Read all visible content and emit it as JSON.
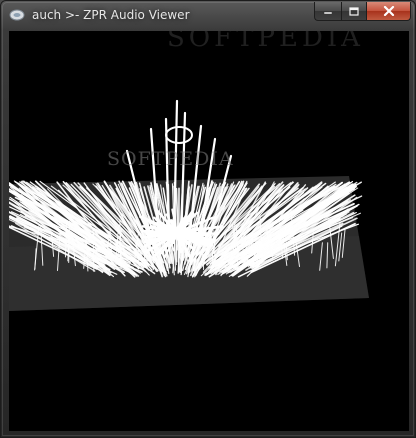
{
  "window": {
    "title": "auch >- ZPR Audio Viewer",
    "icon": "zpr-app-icon"
  },
  "caption_buttons": {
    "minimize_icon": "minimize-icon",
    "maximize_icon": "maximize-icon",
    "close_icon": "close-icon"
  },
  "viewport": {
    "background_color": "#000000",
    "plane_color": "#2b2b2b",
    "spike_color": "#ffffff",
    "watermark_top": "SOFTPEDIA",
    "watermark_mid": "SOFTPEDIA"
  }
}
